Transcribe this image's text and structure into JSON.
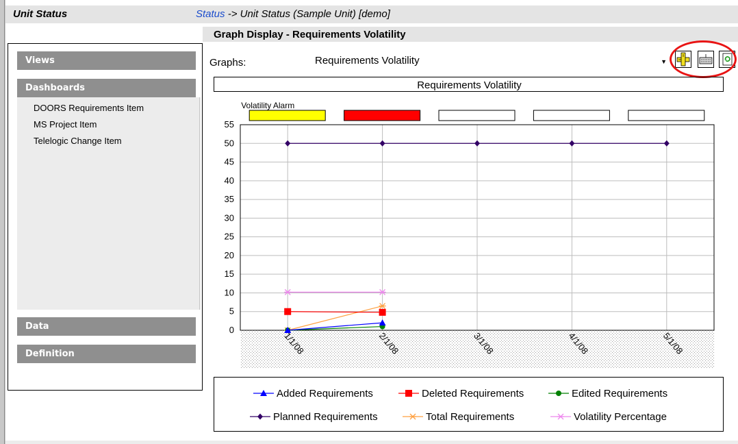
{
  "header": {
    "app_title": "Unit Status",
    "breadcrumb_link": "Status",
    "breadcrumb_rest": " -> Unit Status (Sample Unit) [demo]"
  },
  "subheader": {
    "graph_display_title": "Graph Display - Requirements Volatility"
  },
  "sidebar": {
    "sections": [
      {
        "label": "Views"
      },
      {
        "label": "Dashboards"
      },
      {
        "label": "Data"
      },
      {
        "label": "Definition"
      }
    ],
    "dashboard_items": [
      {
        "label": "DOORS Requirements Item"
      },
      {
        "label": "MS Project Item"
      },
      {
        "label": "Telelogic Change Item"
      }
    ]
  },
  "graphs": {
    "label": "Graphs:",
    "selected": "Requirements Volatility"
  },
  "toolbar": {
    "icons": [
      "ruler-icon",
      "keyboard-icon",
      "refresh-icon"
    ],
    "highlight_color": "#e81414"
  },
  "chart_data": {
    "type": "line",
    "title": "Requirements Volatility",
    "alarm_label": "Volatility Alarm",
    "alarm_colors": [
      "#ffff00",
      "#ff0000",
      "#ffffff",
      "#ffffff",
      "#ffffff"
    ],
    "categories": [
      "1/1/08",
      "2/1/08",
      "3/1/08",
      "4/1/08",
      "5/1/08"
    ],
    "ylim": [
      0,
      55
    ],
    "yticks": [
      0,
      5,
      10,
      15,
      20,
      25,
      30,
      35,
      40,
      45,
      50,
      55
    ],
    "grid": true,
    "legend_position": "bottom",
    "series": [
      {
        "name": "Added Requirements",
        "color": "#0000ff",
        "marker": "triangle",
        "values": [
          0,
          2,
          null,
          null,
          null
        ]
      },
      {
        "name": "Deleted Requirements",
        "color": "#ff0000",
        "marker": "square",
        "values": [
          5,
          4.8,
          null,
          null,
          null
        ]
      },
      {
        "name": "Edited Requirements",
        "color": "#008000",
        "marker": "circle",
        "values": [
          0,
          1,
          null,
          null,
          null
        ]
      },
      {
        "name": "Planned Requirements",
        "color": "#330066",
        "marker": "diamond",
        "values": [
          50,
          50,
          50,
          50,
          50
        ]
      },
      {
        "name": "Total Requirements",
        "color": "#ffa040",
        "marker": "star",
        "values": [
          0,
          6.5,
          null,
          null,
          null
        ]
      },
      {
        "name": "Volatility Percentage",
        "color": "#ee88ee",
        "marker": "star",
        "values": [
          10.2,
          10.2,
          null,
          null,
          null
        ]
      }
    ]
  }
}
